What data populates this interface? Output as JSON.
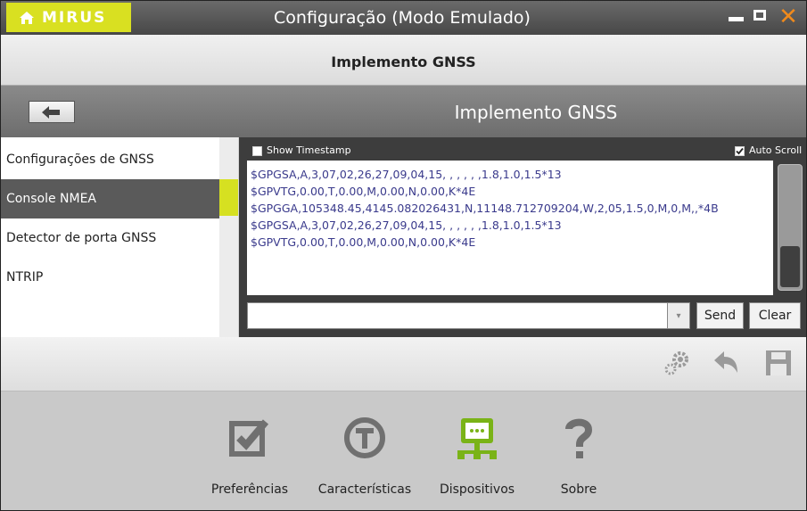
{
  "app": {
    "brand": "MIRUS",
    "window_title": "Configuração (Modo Emulado)"
  },
  "page_title": "Implemento GNSS",
  "section_title": "Implemento GNSS",
  "menu": [
    {
      "label": "Configurações de GNSS"
    },
    {
      "label": "Console NMEA"
    },
    {
      "label": "Detector de porta GNSS"
    },
    {
      "label": "NTRIP"
    }
  ],
  "console": {
    "show_timestamp_label": "Show Timestamp",
    "show_timestamp_checked": false,
    "auto_scroll_label": "Auto Scroll",
    "auto_scroll_checked": true,
    "lines": [
      "$GPGSA,A,3,07,02,26,27,09,04,15, , , , , ,1.8,1.0,1.5*13",
      "$GPVTG,0.00,T,0.00,M,0.00,N,0.00,K*4E",
      "$GPGGA,105348.45,4145.082026431,N,11148.712709204,W,2,05,1.5,0,M,0,M,,*4B",
      "$GPGSA,A,3,07,02,26,27,09,04,15, , , , , ,1.8,1.0,1.5*13",
      "$GPVTG,0.00,T,0.00,M,0.00,N,0.00,K*4E"
    ],
    "input_value": "",
    "send_label": "Send",
    "clear_label": "Clear"
  },
  "bottom_nav": [
    {
      "label": "Preferências",
      "icon": "checkbox-icon"
    },
    {
      "label": "Características",
      "icon": "t-circle-icon"
    },
    {
      "label": "Dispositivos",
      "icon": "network-device-icon"
    },
    {
      "label": "Sobre",
      "icon": "question-icon"
    }
  ],
  "colors": {
    "accent": "#d9e021",
    "close": "#f08a1c",
    "log_text": "#3a3a8c",
    "active_nav": "#7ab317"
  }
}
